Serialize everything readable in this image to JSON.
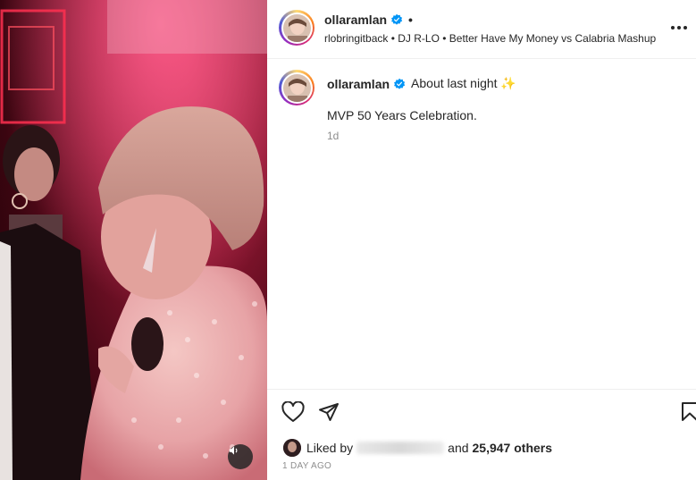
{
  "header": {
    "username": "ollaramlan",
    "separator": "•",
    "audio_line": "rlobringitback • DJ R-LO • Better Have My Money vs Calabria Mashup"
  },
  "caption": {
    "username": "ollaramlan",
    "text": "About last night ✨",
    "body": "MVP 50 Years Celebration.",
    "time": "1d"
  },
  "likes": {
    "prefix": "Liked by",
    "connector": "and",
    "count_text": "25,947 others"
  },
  "date_stamp": "1 DAY AGO",
  "colors": {
    "verified": "#0095f6",
    "text": "#262626",
    "secondary": "#8e8e8e"
  },
  "icons": [
    "verified-badge-icon",
    "more-options-icon",
    "heart-icon",
    "share-icon",
    "bookmark-icon",
    "speaker-icon"
  ]
}
